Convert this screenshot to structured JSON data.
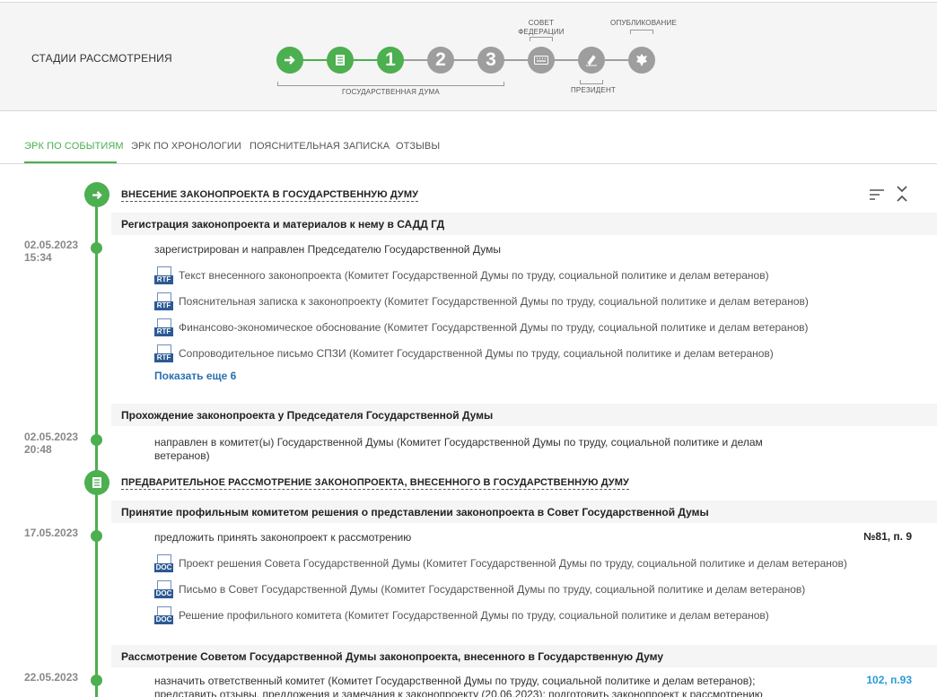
{
  "stages": {
    "title": "СТАДИИ РАССМОТРЕНИЯ",
    "steps": [
      {
        "label": "→",
        "state": "done"
      },
      {
        "label": "▤",
        "state": "done"
      },
      {
        "label": "1",
        "state": "current"
      },
      {
        "label": "2",
        "state": "pending"
      },
      {
        "label": "3",
        "state": "pending"
      },
      {
        "label": "⌨",
        "state": "pending"
      },
      {
        "label": "✍",
        "state": "pending"
      },
      {
        "label": "❖",
        "state": "pending"
      }
    ],
    "captions": {
      "duma": "ГОСУДАРСТВЕННАЯ ДУМА",
      "council": "СОВЕТ ФЕДЕРАЦИИ",
      "president": "ПРЕЗИДЕНТ",
      "published": "ОПУБЛИКОВАНИЕ"
    },
    "colors": {
      "active": "#4caf50",
      "inactive": "#9e9e9e"
    }
  },
  "tabs": [
    {
      "label": "ЭРК ПО СОБЫТИЯМ",
      "active": true
    },
    {
      "label": "ЭРК ПО ХРОНОЛОГИИ",
      "active": false
    },
    {
      "label": "ПОЯСНИТЕЛЬНАЯ ЗАПИСКА",
      "active": false
    },
    {
      "label": "ОТЗЫВЫ",
      "active": false
    }
  ],
  "timeline": {
    "stage1": {
      "heading": "ВНЕСЕНИЕ ЗАКОНОПРОЕКТА В ГОСУДАРСТВЕННУЮ ДУМУ",
      "event1": {
        "title": "Регистрация законопроекта и материалов к нему в САДД ГД",
        "date": "02.05.2023",
        "time": "15:34",
        "text": "зарегистрирован и направлен Председателю Государственной Думы",
        "docs": [
          {
            "type": "RTF",
            "text": "Текст внесенного законопроекта (Комитет Государственной Думы по труду, социальной политике и делам ветеранов)"
          },
          {
            "type": "RTF",
            "text": "Пояснительная записка к законопроекту (Комитет Государственной Думы по труду, социальной политике и делам ветеранов)"
          },
          {
            "type": "RTF",
            "text": "Финансово-экономическое обоснование (Комитет Государственной Думы по труду, социальной политике и делам ветеранов)"
          },
          {
            "type": "RTF",
            "text": "Сопроводительное письмо СПЗИ (Комитет Государственной Думы по труду, социальной политике и делам ветеранов)"
          }
        ],
        "more": "Показать еще 6"
      },
      "event2": {
        "title": "Прохождение законопроекта у Председателя Государственной Думы",
        "date": "02.05.2023",
        "time": "20:48",
        "text_line1": "направлен в комитет(ы) Государственной Думы (Комитет Государственной Думы по труду, социальной политике и делам",
        "text_line2": "ветеранов)"
      }
    },
    "stage2": {
      "heading": "ПРЕДВАРИТЕЛЬНОЕ РАССМОТРЕНИЕ ЗАКОНОПРОЕКТА, ВНЕСЕННОГО В ГОСУДАРСТВЕННУЮ ДУМУ",
      "event1": {
        "title": "Принятие профильным комитетом решения о представлении законопроекта в Совет Государственной Думы",
        "date": "17.05.2023",
        "text": "предложить принять законопроект к рассмотрению",
        "ref": "№81, п. 9",
        "docs": [
          {
            "type": "DOC",
            "text": "Проект решения Совета Государственной Думы (Комитет Государственной Думы по труду, социальной политике и делам ветеранов)"
          },
          {
            "type": "DOC",
            "text": "Письмо в Совет Государственной Думы (Комитет Государственной Думы по труду, социальной политике и делам ветеранов)"
          },
          {
            "type": "DOC",
            "text": "Решение профильного комитета (Комитет Государственной Думы по труду, социальной политике и делам ветеранов)"
          }
        ]
      },
      "event2": {
        "title": "Рассмотрение Советом Государственной Думы законопроекта, внесенного в Государственную Думу",
        "date": "22.05.2023",
        "text_line1": "назначить ответственный комитет (Комитет Государственной Думы по труду, социальной политике и делам ветеранов);",
        "text_line2": "представить отзывы, предложения и замечания к законопроекту (20.06.2023); подготовить законопроект к рассмотрению",
        "ref": "102, п.93"
      }
    }
  }
}
